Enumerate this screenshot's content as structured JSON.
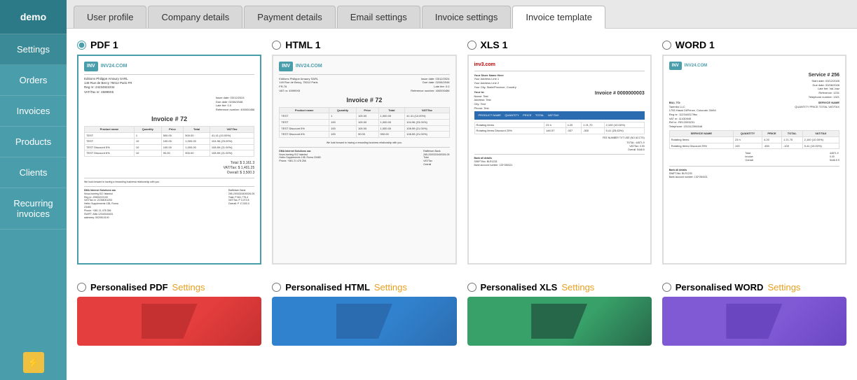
{
  "sidebar": {
    "top_label": "demo",
    "items": [
      {
        "id": "settings",
        "label": "Settings",
        "active": true
      },
      {
        "id": "orders",
        "label": "Orders",
        "active": false
      },
      {
        "id": "invoices",
        "label": "Invoices",
        "active": false
      },
      {
        "id": "products",
        "label": "Products",
        "active": false
      },
      {
        "id": "clients",
        "label": "Clients",
        "active": false
      },
      {
        "id": "recurring",
        "label": "Recurring invoices",
        "active": false
      }
    ],
    "bottom_icon": "⚡"
  },
  "tabs": [
    {
      "id": "user-profile",
      "label": "User profile",
      "active": false
    },
    {
      "id": "company-details",
      "label": "Company details",
      "active": false
    },
    {
      "id": "payment-details",
      "label": "Payment details",
      "active": false
    },
    {
      "id": "email-settings",
      "label": "Email settings",
      "active": false
    },
    {
      "id": "invoice-settings",
      "label": "Invoice settings",
      "active": false
    },
    {
      "id": "invoice-template",
      "label": "Invoice template",
      "active": true
    }
  ],
  "templates": [
    {
      "id": "pdf1",
      "label": "PDF 1",
      "selected": true,
      "type": "pdf"
    },
    {
      "id": "html1",
      "label": "HTML 1",
      "selected": false,
      "type": "html"
    },
    {
      "id": "xls1",
      "label": "XLS 1",
      "selected": false,
      "type": "xls"
    },
    {
      "id": "word1",
      "label": "WORD 1",
      "selected": false,
      "type": "word"
    }
  ],
  "personalised": [
    {
      "id": "pers-pdf",
      "bold": "Personalised PDF",
      "link": "Settings",
      "color": "red"
    },
    {
      "id": "pers-html",
      "bold": "Personalised HTML",
      "link": "Settings",
      "color": "blue"
    },
    {
      "id": "pers-xls",
      "bold": "Personalised XLS",
      "link": "Settings",
      "color": "green"
    },
    {
      "id": "pers-word",
      "bold": "Personalised WORD",
      "link": "Settings",
      "color": "purple"
    }
  ],
  "invoice_preview": {
    "logo_text": "INV24.COM",
    "invoice_number": "Invoice # 72",
    "billing_label": "Bill to:",
    "company_name": "Editions Philippe Amaury SARL",
    "address": "149 Rue de Bercy 75012 Paris FR",
    "columns": [
      "Product name",
      "Quantity",
      "Price",
      "Total",
      "VAT/Tax"
    ],
    "rows": [
      [
        "TEST",
        "1",
        "500.00",
        "500.00",
        "41.41 (10.00%)"
      ],
      [
        "TEST",
        "10",
        "100.00",
        "1,000.00",
        "104.96 (23.00%)"
      ],
      [
        "TEST Discount 5%",
        "10",
        "100.00",
        "1,000.00",
        "108.59 (21.00%)"
      ],
      [
        "TEST Discount 6%",
        "10",
        "90.00",
        "900.00",
        "108.59 (21.00%)"
      ]
    ],
    "total_label": "Total:",
    "total_value": "$ 3,161.3"
  }
}
